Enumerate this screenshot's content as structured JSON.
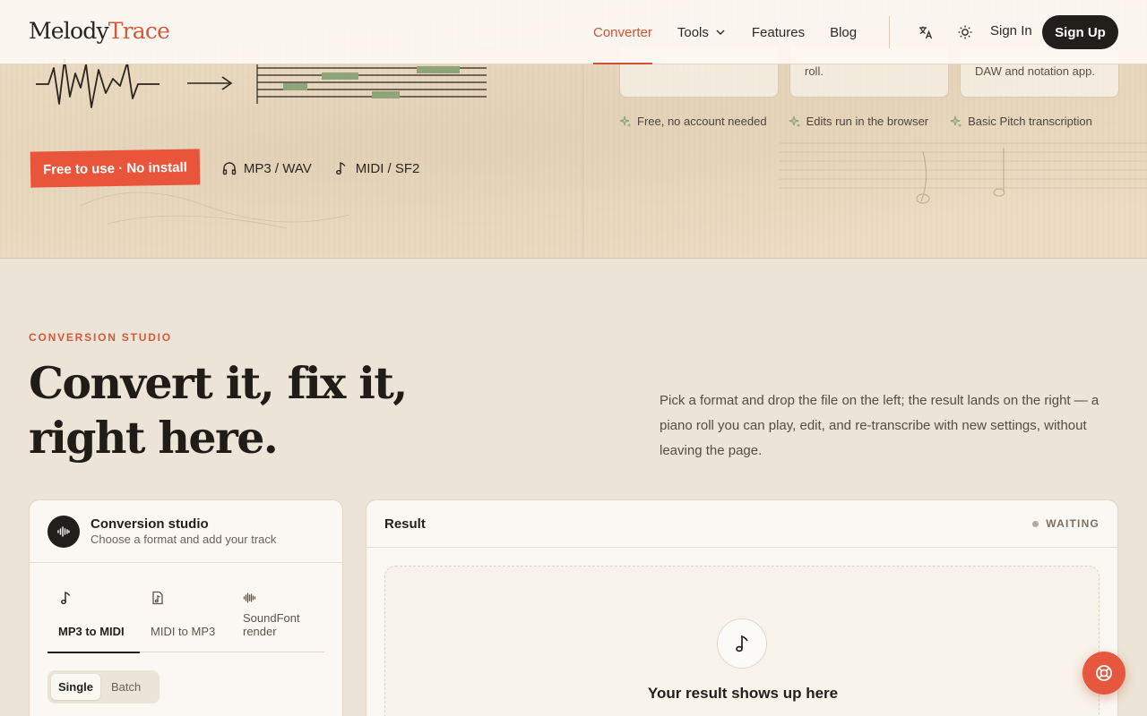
{
  "brand": {
    "name_part1": "Melody",
    "name_part2": "Trace"
  },
  "nav": {
    "links": [
      {
        "label": "Converter"
      },
      {
        "label": "Tools"
      },
      {
        "label": "Features"
      },
      {
        "label": "Blog"
      }
    ],
    "sign_in": "Sign In",
    "sign_up": "Sign Up"
  },
  "hero": {
    "tag": "Free to use · No install",
    "formats": [
      "MP3 / WAV",
      "MIDI / SF2"
    ],
    "feature_cards": [
      "roll.",
      "DAW and notation app."
    ],
    "badges": [
      "Free, no account needed",
      "Edits run in the browser",
      "Basic Pitch transcription"
    ]
  },
  "section": {
    "eyebrow": "CONVERSION STUDIO",
    "title": "Convert it, fix it, right here.",
    "description": "Pick a format and drop the file on the left; the result lands on the right — a piano roll you can play, edit, and re-transcribe with new settings, without leaving the page."
  },
  "studio": {
    "title": "Conversion studio",
    "subtitle": "Choose a format and add your track",
    "modes": [
      {
        "label": "MP3 to MIDI",
        "icon": "music-note-icon"
      },
      {
        "label": "MIDI to MP3",
        "icon": "music-file-icon"
      },
      {
        "label": "SoundFont render",
        "icon": "waveform-icon"
      }
    ],
    "toggle": [
      "Single",
      "Batch"
    ]
  },
  "result": {
    "title": "Result",
    "status": "WAITING",
    "empty_title": "Your result shows up here"
  },
  "colors": {
    "accent": "#e8553b",
    "dark": "#221e1b",
    "background": "#ece4d6"
  }
}
